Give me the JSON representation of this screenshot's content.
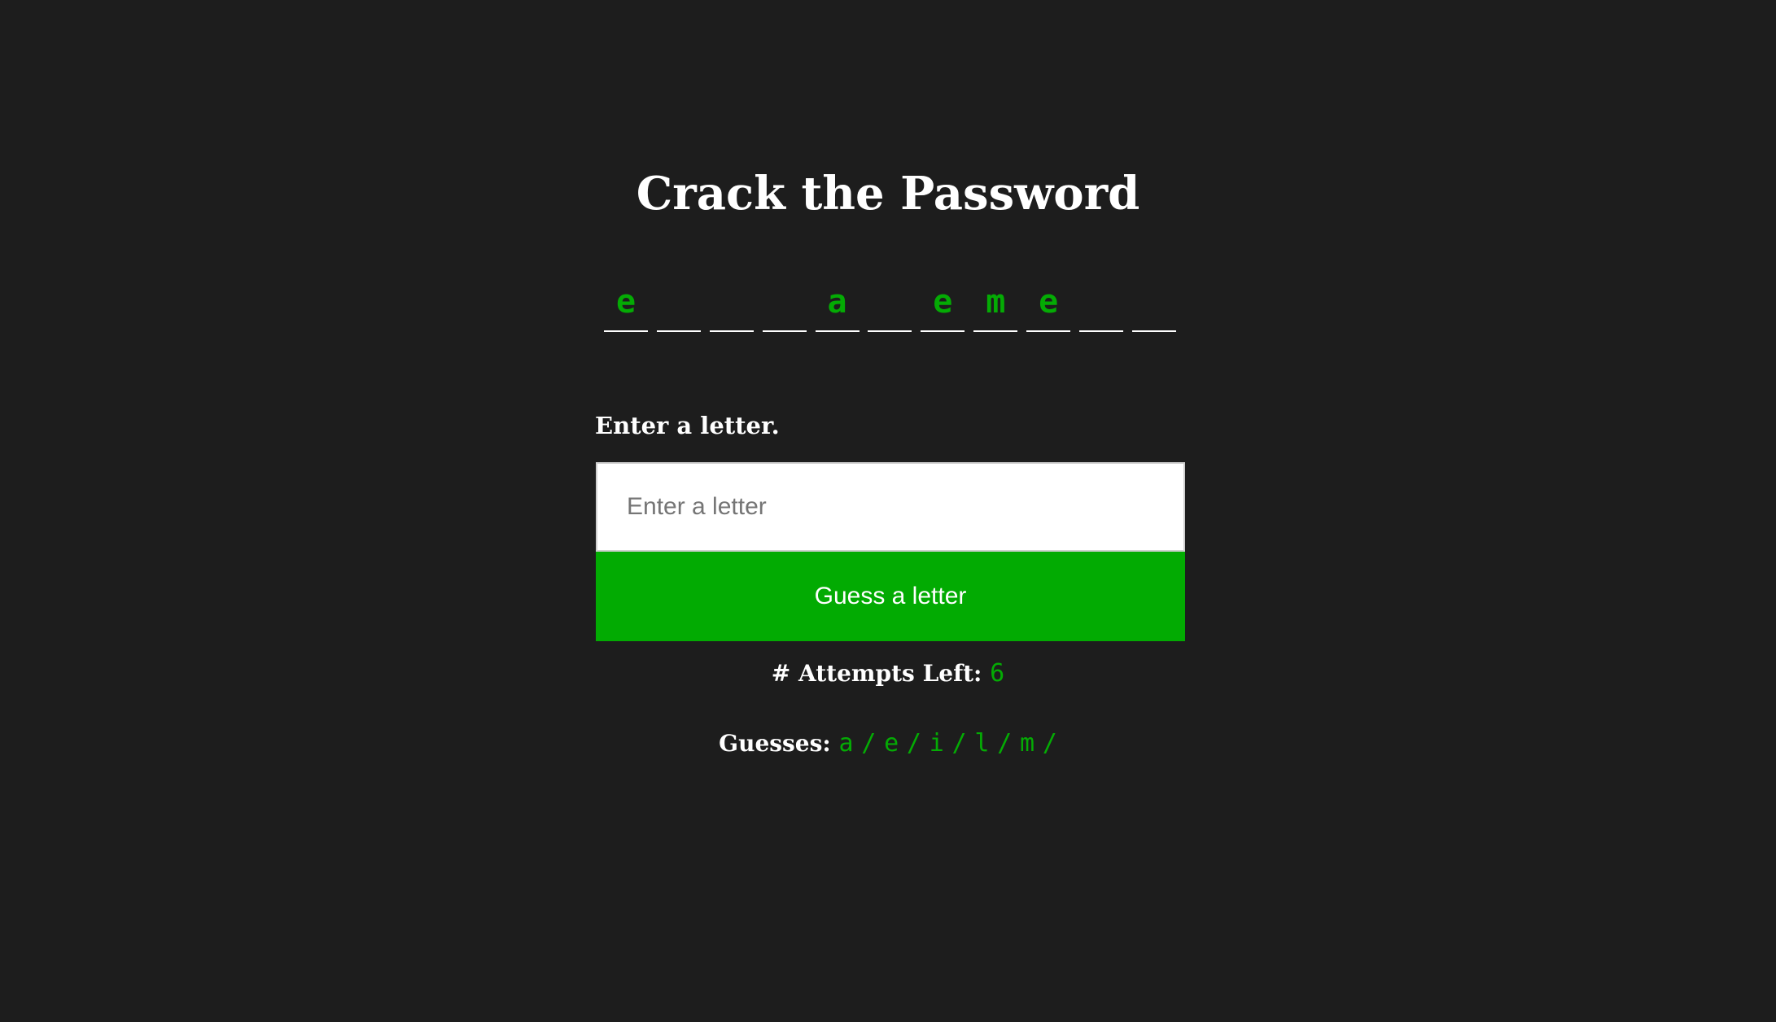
{
  "title": "Crack the Password",
  "word_slots": [
    "e",
    "",
    "",
    "",
    "a",
    "",
    "e",
    "m",
    "e",
    "",
    ""
  ],
  "prompt": {
    "label": "Enter a letter.",
    "placeholder": "Enter a letter",
    "value": "",
    "button_label": "Guess a letter"
  },
  "attempts": {
    "label": "# Attempts Left:",
    "value": "6"
  },
  "guesses": {
    "label": "Guesses:",
    "letters": [
      "a",
      "e",
      "i",
      "l",
      "m"
    ],
    "separator": "/"
  },
  "colors": {
    "background": "#1d1d1d",
    "accent": "#02ab02",
    "text": "#ffffff"
  }
}
